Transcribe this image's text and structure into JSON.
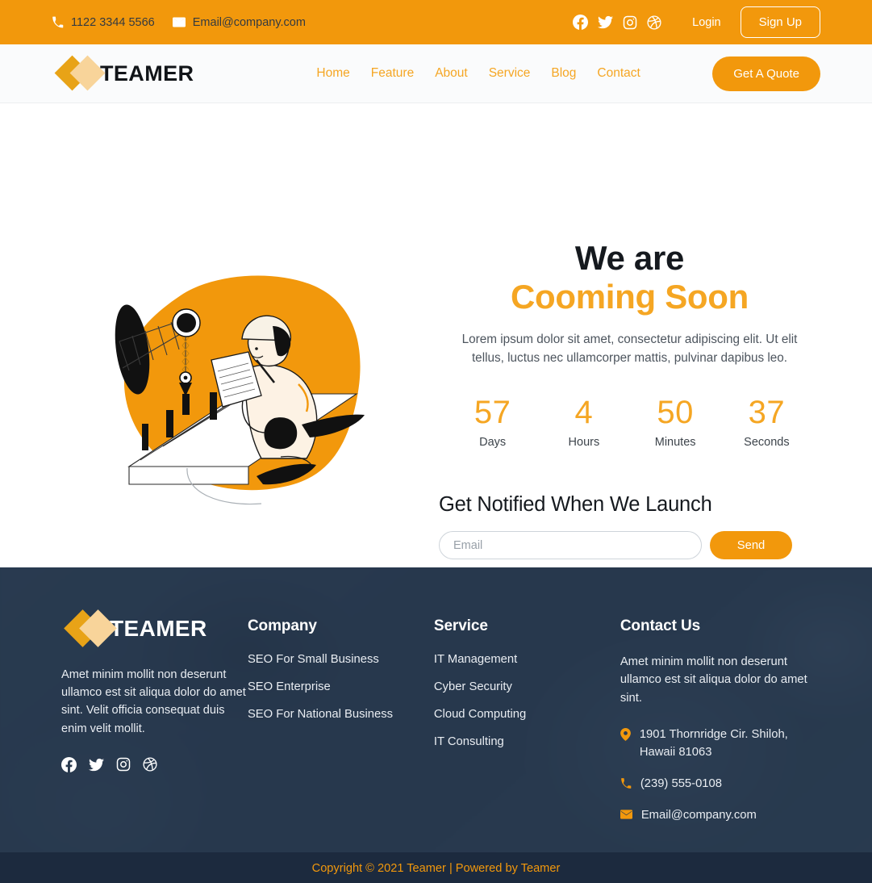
{
  "topbar": {
    "phone": "1122 3344 5566",
    "email": "Email@company.com",
    "phone_icon": "phone-icon",
    "email_icon": "envelope-icon",
    "socials": [
      "facebook-icon",
      "twitter-icon",
      "instagram-icon",
      "dribbble-icon"
    ],
    "login_label": "Login",
    "signup_label": "Sign Up",
    "bg_color": "#f2980c"
  },
  "navbar": {
    "logo_text": "TEAMER",
    "links": [
      {
        "label": "Home"
      },
      {
        "label": "Feature"
      },
      {
        "label": "About"
      },
      {
        "label": "Service"
      },
      {
        "label": "Blog"
      },
      {
        "label": "Contact"
      }
    ],
    "cta_label": "Get A Quote",
    "link_color": "#f5a623",
    "cta_color": "#f2980c"
  },
  "hero": {
    "illustration": "construction-worker-blueprint-illustration",
    "title_line1": "We are",
    "title_line2": "Cooming Soon",
    "subtitle": "Lorem ipsum dolor sit amet, consectetur adipiscing elit. Ut elit tellus, luctus nec ullamcorper mattis, pulvinar dapibus leo.",
    "countdown": [
      {
        "value": "57",
        "label": "Days"
      },
      {
        "value": "4",
        "label": "Hours"
      },
      {
        "value": "50",
        "label": "Minutes"
      },
      {
        "value": "37",
        "label": "Seconds"
      }
    ],
    "notify_heading": "Get Notified When We Launch",
    "email_placeholder": "Email",
    "email_value": "",
    "send_label": "Send",
    "accent_color": "#f5a623"
  },
  "footer": {
    "brand": {
      "logo_text": "TEAMER",
      "description": "Amet minim mollit non deserunt ullamco est sit aliqua dolor do amet sint. Velit officia consequat duis enim velit mollit.",
      "socials": [
        "facebook-icon",
        "twitter-icon",
        "instagram-icon",
        "dribbble-icon"
      ]
    },
    "company": {
      "heading": "Company",
      "links": [
        {
          "label": "SEO For Small Business"
        },
        {
          "label": "SEO Enterprise"
        },
        {
          "label": "SEO For National Business"
        }
      ]
    },
    "service": {
      "heading": "Service",
      "links": [
        {
          "label": "IT Management"
        },
        {
          "label": "Cyber Security"
        },
        {
          "label": "Cloud Computing"
        },
        {
          "label": "IT Consulting"
        }
      ]
    },
    "contact": {
      "heading": "Contact Us",
      "description": "Amet minim mollit non deserunt ullamco est sit aliqua dolor do amet sint.",
      "address": "1901 Thornridge Cir. Shiloh, Hawaii 81063",
      "phone": "(239) 555-0108",
      "email": "Email@company.com",
      "address_icon": "location-pin-icon",
      "phone_icon": "phone-icon",
      "email_icon": "envelope-icon"
    },
    "copyright": "Copyright © 2021 Teamer | Powered by Teamer",
    "bg_color": "#2d3c4f",
    "copyright_bg": "#1c2a3e",
    "copyright_color": "#f2980c"
  }
}
